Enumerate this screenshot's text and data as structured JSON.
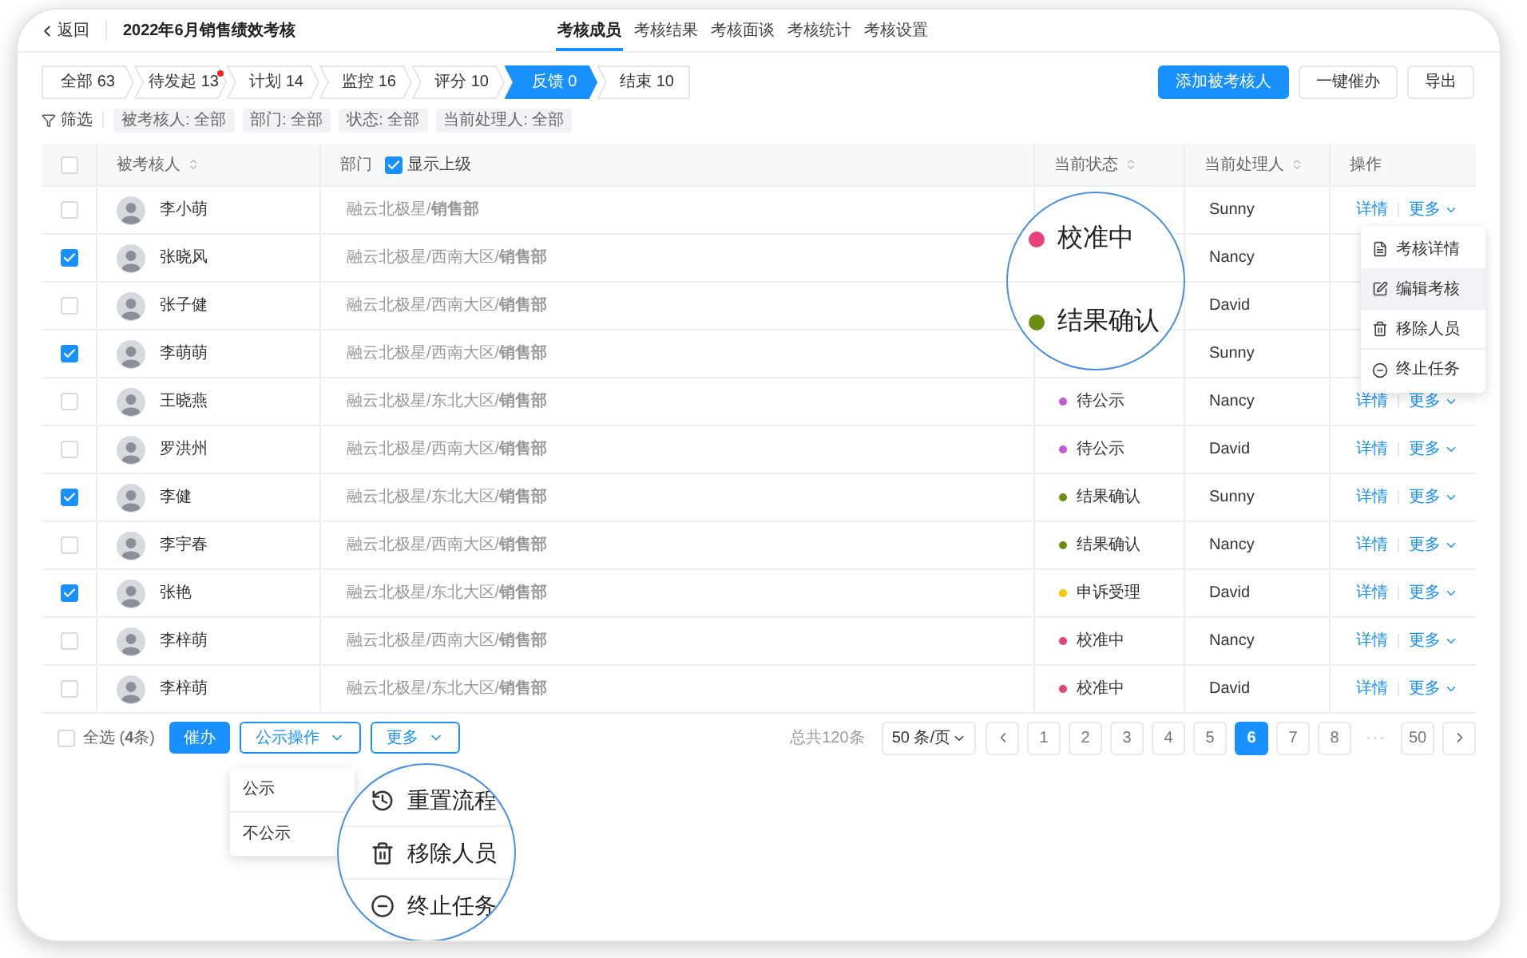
{
  "header": {
    "back": "返回",
    "title": "2022年6月销售绩效考核",
    "tabs": [
      {
        "label": "考核成员",
        "selected": true
      },
      {
        "label": "考核结果",
        "selected": false
      },
      {
        "label": "考核面谈",
        "selected": false
      },
      {
        "label": "考核统计",
        "selected": false
      },
      {
        "label": "考核设置",
        "selected": false
      }
    ]
  },
  "steps": [
    {
      "label": "全部 63",
      "selected": false,
      "badge": false
    },
    {
      "label": "待发起 13",
      "selected": false,
      "badge": true
    },
    {
      "label": "计划 14",
      "selected": false,
      "badge": false
    },
    {
      "label": "监控 16",
      "selected": false,
      "badge": false
    },
    {
      "label": "评分 10",
      "selected": false,
      "badge": false
    },
    {
      "label": "反馈 0",
      "selected": true,
      "badge": false
    },
    {
      "label": "结束 10",
      "selected": false,
      "badge": false
    }
  ],
  "toolbar_buttons": [
    {
      "label": "添加被考核人",
      "kind": "primary"
    },
    {
      "label": "一键催办",
      "kind": "default"
    },
    {
      "label": "导出",
      "kind": "default"
    }
  ],
  "filter": {
    "label": "筛选",
    "chips": [
      "被考核人: 全部",
      "部门: 全部",
      "状态: 全部",
      "当前处理人: 全部"
    ]
  },
  "table": {
    "header_checked": false,
    "columns": [
      {
        "label": "被考核人",
        "sortable": true
      },
      {
        "label": "部门",
        "sortable": false,
        "option": {
          "label": "显示上级",
          "checked": true
        }
      },
      {
        "label": "当前状态",
        "sortable": true
      },
      {
        "label": "当前处理人",
        "sortable": true
      },
      {
        "label": "操作",
        "sortable": false
      }
    ],
    "rows": [
      {
        "checked": false,
        "name": "李小萌",
        "department": "融云北极星/**销售部**",
        "handler": "Sunny",
        "actions": {
          "detail": "详情",
          "more": "更多"
        }
      },
      {
        "checked": true,
        "name": "张晓风",
        "department": "融云北极星/西南大区/**销售部**",
        "handler": "Nancy"
      },
      {
        "checked": false,
        "name": "张子健",
        "department": "融云北极星/西南大区/**销售部**",
        "handler": "David"
      },
      {
        "checked": true,
        "name": "李萌萌",
        "department": "融云北极星/西南大区/**销售部**",
        "handler": "Sunny"
      },
      {
        "checked": false,
        "name": "王晓燕",
        "department": "融云北极星/东北大区/**销售部**",
        "status": {
          "label": "待公示",
          "color": "#c45bd6"
        },
        "handler": "Nancy",
        "actions": {
          "detail": "详情",
          "more": "更多"
        }
      },
      {
        "checked": false,
        "name": "罗洪州",
        "department": "融云北极星/西南大区/**销售部**",
        "status": {
          "label": "待公示",
          "color": "#c45bd6"
        },
        "handler": "David",
        "actions": {
          "detail": "详情",
          "more": "更多"
        }
      },
      {
        "checked": true,
        "name": "李健",
        "department": "融云北极星/东北大区/**销售部**",
        "status": {
          "label": "结果确认",
          "color": "#6b8e10"
        },
        "handler": "Sunny",
        "actions": {
          "detail": "详情",
          "more": "更多"
        }
      },
      {
        "checked": false,
        "name": "李宇春",
        "department": "融云北极星/西南大区/**销售部**",
        "status": {
          "label": "结果确认",
          "color": "#6b8e10"
        },
        "handler": "Nancy",
        "actions": {
          "detail": "详情",
          "more": "更多"
        }
      },
      {
        "checked": true,
        "name": "张艳",
        "department": "融云北极星/东北大区/**销售部**",
        "status": {
          "label": "申诉受理",
          "color": "#f5c400"
        },
        "handler": "David",
        "actions": {
          "detail": "详情",
          "more": "更多"
        }
      },
      {
        "checked": false,
        "name": "李梓萌",
        "department": "融云北极星/西南大区/**销售部**",
        "status": {
          "label": "校准中",
          "color": "#e8407a"
        },
        "handler": "Nancy",
        "actions": {
          "detail": "详情",
          "more": "更多"
        }
      },
      {
        "checked": false,
        "name": "李梓萌",
        "department": "融云北极星/东北大区/**销售部**",
        "status": {
          "label": "校准中",
          "color": "#e8407a"
        },
        "handler": "David",
        "actions": {
          "detail": "详情",
          "more": "更多"
        }
      }
    ]
  },
  "status_magnifier": [
    {
      "label": "校准中",
      "color": "#e8407a"
    },
    {
      "label": "结果确认",
      "color": "#6b8e10"
    }
  ],
  "row_menu": [
    {
      "kind": "detail",
      "label": "考核详情",
      "highlighted": false
    },
    {
      "kind": "edit",
      "label": "编辑考核",
      "highlighted": true
    },
    {
      "kind": "remove",
      "label": "移除人员",
      "highlighted": false
    },
    {
      "kind": "stop",
      "label": "终止任务",
      "highlighted": false
    }
  ],
  "footer": {
    "select_all": {
      "label": "全选 (**4**条)",
      "checked": false
    },
    "buttons": [
      {
        "label": "催办",
        "kind": "primary"
      },
      {
        "label": "公示操作",
        "kind": "dropdown"
      },
      {
        "label": "更多",
        "kind": "dropdown"
      }
    ],
    "publish_menu": [
      "公示",
      "不公示"
    ],
    "more_magnifier": [
      {
        "kind": "reset",
        "label": "重置流程"
      },
      {
        "kind": "remove",
        "label": "移除人员"
      },
      {
        "kind": "stop",
        "label": "终止任务"
      }
    ],
    "pagination": {
      "total": "总共120条",
      "page_size": "50 条/页",
      "pages": [
        {
          "label": "1",
          "kind": "page",
          "selected": false
        },
        {
          "label": "2",
          "kind": "page",
          "selected": false
        },
        {
          "label": "3",
          "kind": "page",
          "selected": false
        },
        {
          "label": "4",
          "kind": "page",
          "selected": false
        },
        {
          "label": "5",
          "kind": "page",
          "selected": false
        },
        {
          "label": "6",
          "kind": "page",
          "selected": true
        },
        {
          "label": "7",
          "kind": "page",
          "selected": false
        },
        {
          "label": "8",
          "kind": "page",
          "selected": false
        },
        {
          "label": "···",
          "kind": "ellipsis"
        },
        {
          "label": "50",
          "kind": "page",
          "selected": false
        }
      ]
    }
  }
}
